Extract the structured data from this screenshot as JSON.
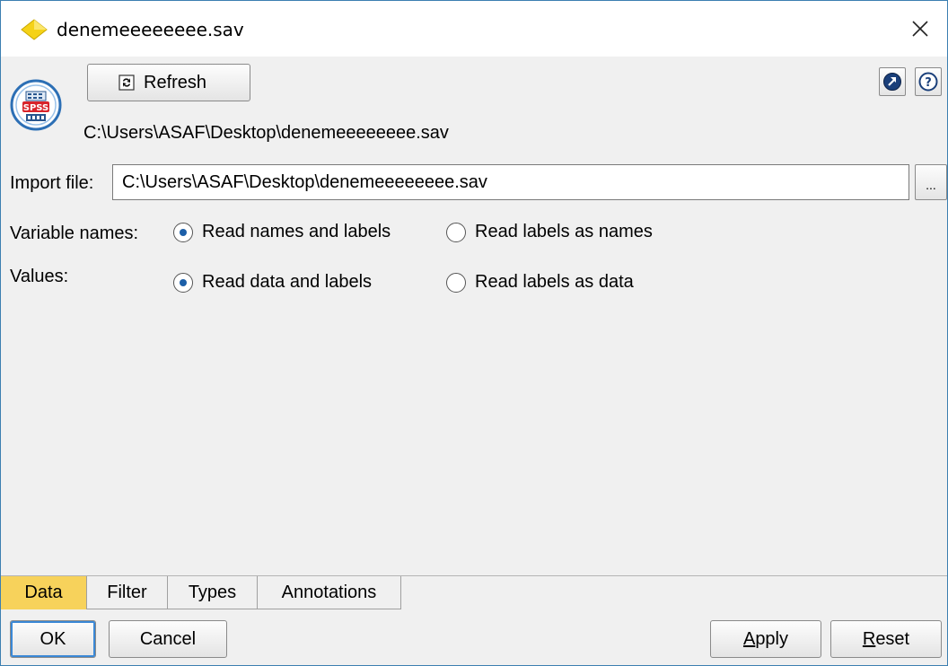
{
  "window": {
    "title": "denemeeeeeeee.sav"
  },
  "toolbar": {
    "refresh_label": "Refresh",
    "file_path": "C:\\Users\\ASAF\\Desktop\\denemeeeeeeee.sav"
  },
  "import_file": {
    "label": "Import file:",
    "value": "C:\\Users\\ASAF\\Desktop\\denemeeeeeeee.sav",
    "browse_label": "..."
  },
  "variable_names": {
    "label": "Variable names:",
    "options": [
      "Read names and labels",
      "Read labels as names"
    ],
    "selected": "Read names and labels"
  },
  "values": {
    "label": "Values:",
    "options": [
      "Read data and labels",
      "Read labels as data"
    ],
    "selected": "Read data and labels"
  },
  "tabs": [
    {
      "label": "Data",
      "active": true
    },
    {
      "label": "Filter",
      "active": false
    },
    {
      "label": "Types",
      "active": false
    },
    {
      "label": "Annotations",
      "active": false
    }
  ],
  "buttons": {
    "ok": "OK",
    "cancel": "Cancel",
    "apply_mnemonic": "A",
    "apply_rest": "pply",
    "reset_mnemonic": "R",
    "reset_rest": "eset"
  },
  "colors": {
    "active_tab": "#f7d25b",
    "radio_dot": "#1c5fa8",
    "focus_ring": "#3a88d6"
  },
  "icons": {
    "title": "yellow-diamond-icon",
    "close": "close-icon",
    "node": "spss-file-icon",
    "refresh": "refresh-icon",
    "toolbar_right": [
      "launch-arrow-icon",
      "help-icon"
    ]
  }
}
